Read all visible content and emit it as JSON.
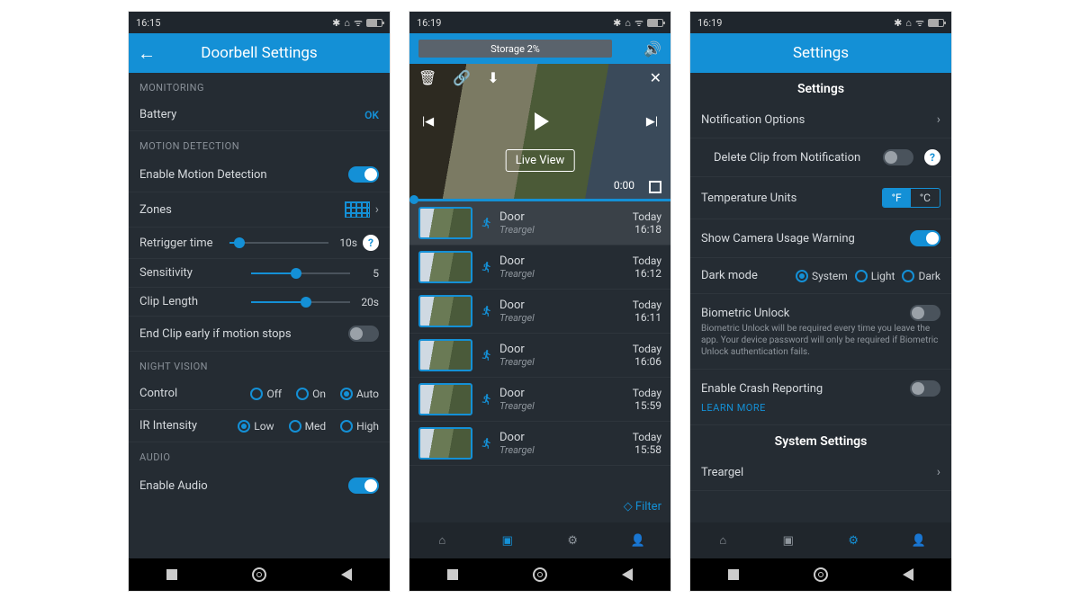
{
  "p1": {
    "status_time": "16:15",
    "title": "Doorbell Settings",
    "sect_monitoring": "MONITORING",
    "battery_label": "Battery",
    "battery_value": "OK",
    "sect_motion": "MOTION DETECTION",
    "enable_motion": "Enable Motion Detection",
    "zones": "Zones",
    "retrigger": "Retrigger time",
    "retrigger_val": "10s",
    "sensitivity": "Sensitivity",
    "sensitivity_val": "5",
    "cliplen": "Clip Length",
    "cliplen_val": "20s",
    "endclip": "End Clip early if motion stops",
    "sect_night": "NIGHT VISION",
    "control": "Control",
    "off": "Off",
    "on": "On",
    "auto": "Auto",
    "ir": "IR Intensity",
    "low": "Low",
    "med": "Med",
    "high": "High",
    "sect_audio": "AUDIO",
    "enable_audio": "Enable Audio"
  },
  "p2": {
    "status_time": "16:19",
    "storage": "Storage 2%",
    "live": "Live View",
    "timer": "0:00",
    "filter": "◇ Filter",
    "clips": [
      {
        "loc": "Door",
        "cam": "Treargel",
        "day": "Today",
        "time": "16:18",
        "sel": true
      },
      {
        "loc": "Door",
        "cam": "Treargel",
        "day": "Today",
        "time": "16:12"
      },
      {
        "loc": "Door",
        "cam": "Treargel",
        "day": "Today",
        "time": "16:11"
      },
      {
        "loc": "Door",
        "cam": "Treargel",
        "day": "Today",
        "time": "16:06"
      },
      {
        "loc": "Door",
        "cam": "Treargel",
        "day": "Today",
        "time": "15:59"
      },
      {
        "loc": "Door",
        "cam": "Treargel",
        "day": "Today",
        "time": "15:58"
      }
    ]
  },
  "p3": {
    "status_time": "16:19",
    "title": "Settings",
    "subhead1": "Settings",
    "notif": "Notification Options",
    "deleteclip": "Delete Clip from Notification",
    "tempunits": "Temperature Units",
    "degF": "°F",
    "degC": "°C",
    "camwarn": "Show Camera Usage Warning",
    "darkmode": "Dark mode",
    "system": "System",
    "light": "Light",
    "dark": "Dark",
    "biometric": "Biometric Unlock",
    "biometric_desc": "Biometric Unlock will be required every time you leave the app. Your device password will only be required if Biometric Unlock authentication fails.",
    "crash": "Enable Crash Reporting",
    "learn": "LEARN MORE",
    "subhead2": "System Settings",
    "system_item": "Treargel"
  }
}
